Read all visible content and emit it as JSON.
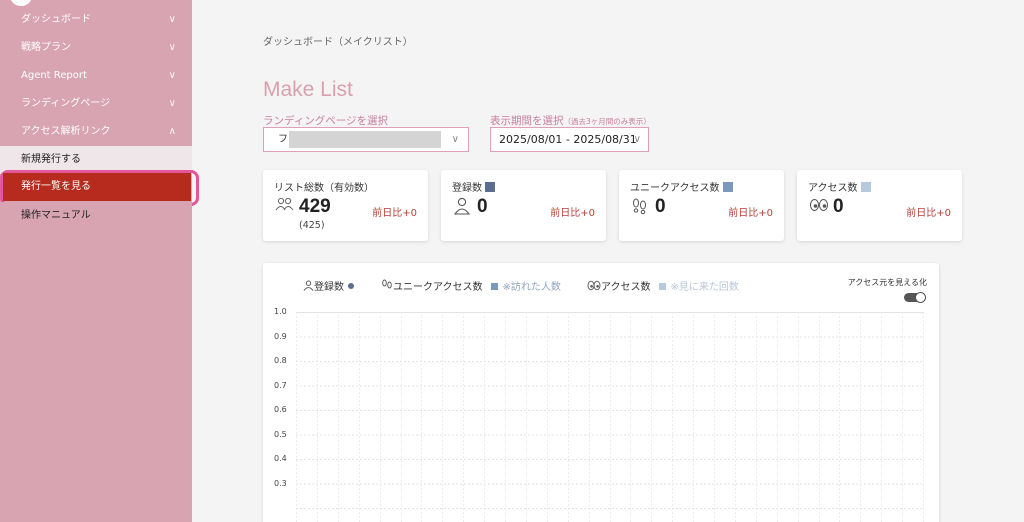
{
  "sidebar": {
    "items": [
      {
        "label": "ダッシュボード",
        "chevron": "∨"
      },
      {
        "label": "戦略プラン",
        "chevron": "∨"
      },
      {
        "label": "Agent Report",
        "chevron": "∨"
      },
      {
        "label": "ランディングページ",
        "chevron": "∨"
      },
      {
        "label": "アクセス解析リンク",
        "chevron": "∧"
      }
    ],
    "subitems": [
      {
        "label": "新規発行する"
      },
      {
        "label": "発行一覧を見る",
        "active": true
      },
      {
        "label": "操作マニュアル"
      }
    ]
  },
  "breadcrumb": "ダッシュボード（メイクリスト）",
  "page_title": "Make List",
  "filters": {
    "lp_label": "ランディングページを選択",
    "lp_value": "フ",
    "period_label": "表示期間を選択",
    "period_note": "（過去3ヶ月間のみ表示）",
    "period_value": "2025/08/01 - 2025/08/31"
  },
  "cards": [
    {
      "title": "リスト総数（有効数）",
      "value": "429",
      "sub": "(425)",
      "compare": "前日比+0",
      "icon": "people-icon",
      "square_color": ""
    },
    {
      "title": "登録数",
      "value": "0",
      "sub": "",
      "compare": "前日比+0",
      "icon": "person-icon",
      "square_color": "#5a6f8f"
    },
    {
      "title": "ユニークアクセス数",
      "value": "0",
      "sub": "",
      "compare": "前日比+0",
      "icon": "footprints-icon",
      "square_color": "#7d98bd"
    },
    {
      "title": "アクセス数",
      "value": "0",
      "sub": "",
      "compare": "前日比+0",
      "icon": "eyes-icon",
      "square_color": "#b7c9dc"
    }
  ],
  "chart": {
    "legend": {
      "registrations": "登録数",
      "unique_access": "ユニークアクセス数",
      "unique_note": "※訪れた人数",
      "access": "アクセス数",
      "access_note": "※見に来た回数"
    },
    "toggle_label": "アクセス元を見える化",
    "colors": {
      "registrations": "#5a6f8f",
      "unique": "#7d98bd",
      "access": "#b7c9dc"
    }
  },
  "chart_data": {
    "type": "line",
    "title": "",
    "xlabel": "",
    "ylabel": "",
    "ylim": [
      0,
      1.0
    ],
    "yticks": [
      "1.0",
      "0.9",
      "0.8",
      "0.7",
      "0.6",
      "0.5",
      "0.4",
      "0.3"
    ],
    "grid": true,
    "series": [
      {
        "name": "登録数",
        "values": []
      },
      {
        "name": "ユニークアクセス数",
        "values": []
      },
      {
        "name": "アクセス数",
        "values": []
      }
    ]
  }
}
